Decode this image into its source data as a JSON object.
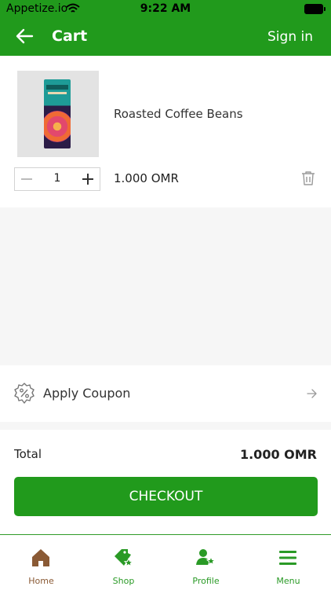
{
  "status_bar": {
    "carrier": "Appetize.io",
    "time": "9:22 AM"
  },
  "header": {
    "title": "Cart",
    "sign_in_label": "Sign in"
  },
  "cart": {
    "items": [
      {
        "name": "Roasted Coffee Beans",
        "quantity": "1",
        "price": "1.000 OMR"
      }
    ]
  },
  "coupon": {
    "label": "Apply Coupon"
  },
  "summary": {
    "total_label": "Total",
    "total_value": "1.000 OMR",
    "checkout_label": "CHECKOUT"
  },
  "bottom_nav": {
    "tabs": [
      {
        "label": "Home",
        "icon": "home-icon"
      },
      {
        "label": "Shop",
        "icon": "shop-tag-icon"
      },
      {
        "label": "Profile",
        "icon": "profile-icon"
      },
      {
        "label": "Menu",
        "icon": "menu-icon"
      }
    ]
  },
  "colors": {
    "primary": "#219a1c",
    "home_tab": "#8a5a35",
    "background": "#f6f6f6"
  }
}
